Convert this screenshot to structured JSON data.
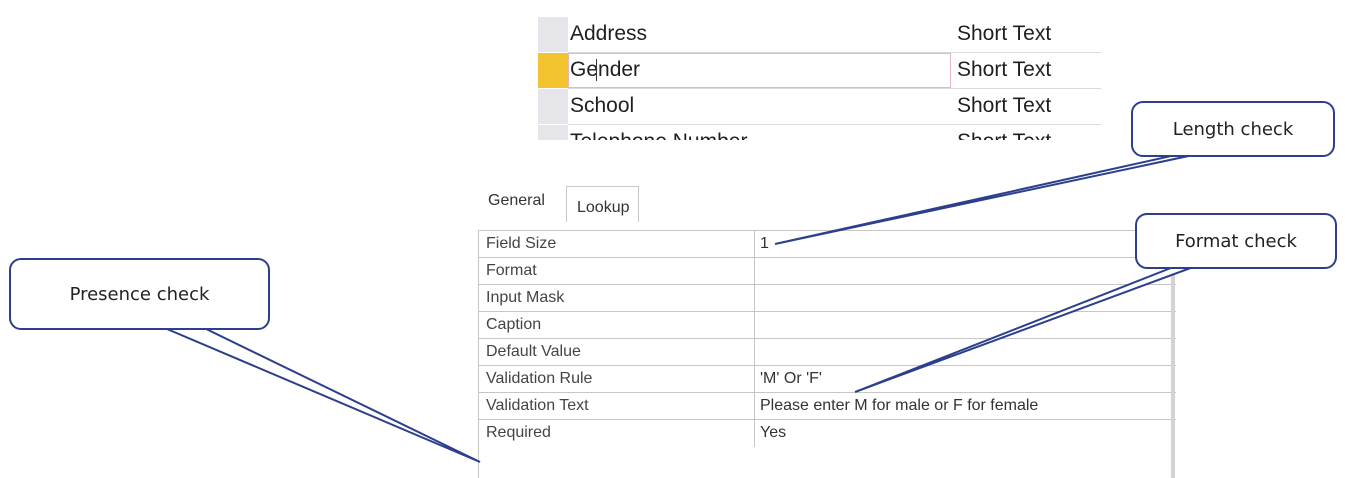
{
  "fields": [
    {
      "name": "Address",
      "type": "Short Text"
    },
    {
      "name": "Gender",
      "type": "Short Text"
    },
    {
      "name": "School",
      "type": "Short Text"
    },
    {
      "name": "Telephone Number",
      "type": "Short Text"
    }
  ],
  "tabs": {
    "general": "General",
    "lookup": "Lookup"
  },
  "properties": [
    {
      "name": "Field Size",
      "value": "1"
    },
    {
      "name": "Format",
      "value": ""
    },
    {
      "name": "Input Mask",
      "value": ""
    },
    {
      "name": "Caption",
      "value": ""
    },
    {
      "name": "Default Value",
      "value": ""
    },
    {
      "name": "Validation Rule",
      "value": "'M' Or 'F'"
    },
    {
      "name": "Validation Text",
      "value": "Please enter M for male or F for female"
    },
    {
      "name": "Required",
      "value": "Yes"
    }
  ],
  "callouts": {
    "length": "Length check",
    "format": "Format check",
    "presence": "Presence check"
  },
  "colors": {
    "callout_border": "#2c3f8c",
    "active_row_selector": "#f4c430"
  }
}
